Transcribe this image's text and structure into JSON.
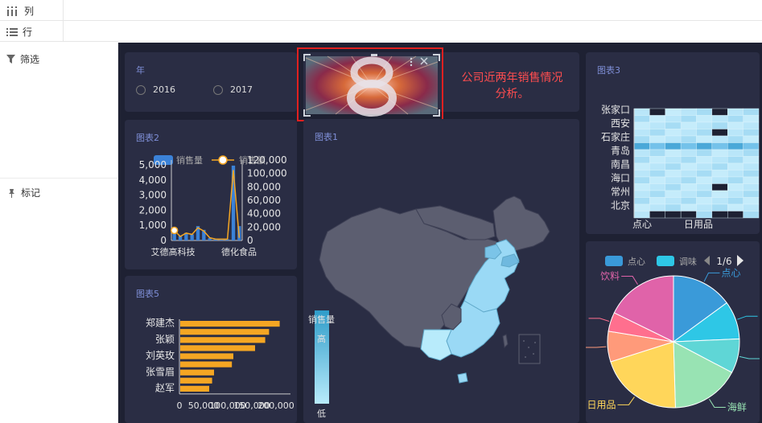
{
  "shelf": {
    "columns_label": "列",
    "rows_label": "行"
  },
  "side": {
    "filter_label": "筛选",
    "mark_label": "标记"
  },
  "year_panel": {
    "title": "年",
    "options": [
      "2016",
      "2017"
    ]
  },
  "title_panel": {
    "line1": "公司近两年销售情况",
    "line2": "分析。"
  },
  "chart2": {
    "title": "图表2"
  },
  "chart1": {
    "title": "图表1",
    "legend_title": "销售量",
    "high": "高",
    "low": "低"
  },
  "chart3": {
    "title": "图表3"
  },
  "chart5": {
    "title": "图表5"
  },
  "pie": {
    "page": "1/6"
  },
  "colors": {
    "accent_title": "#7f8fd8",
    "bar_orange": "#f5a623",
    "bar_blue": "#3b82d8",
    "map_fill": "#5c5e70",
    "map_high": "#9ad9f5",
    "title_red": "#ff4d4f"
  },
  "chart_data": [
    {
      "type": "bar",
      "title": "图表2",
      "legend": [
        "销售量",
        "销售额"
      ],
      "categories": [
        "艾德高科技",
        "",
        "",
        "",
        "",
        "",
        "",
        "",
        "",
        "",
        "",
        "德化食品"
      ],
      "y_ticks": [
        "5,000",
        "4,000",
        "3,000",
        "2,000",
        "1,000",
        "0"
      ],
      "y2_ticks": [
        "120,000",
        "100,000",
        "80,000",
        "60,000",
        "40,000",
        "20,000",
        "0"
      ],
      "series": [
        {
          "name": "销售量",
          "values": [
            650,
            300,
            500,
            400,
            950,
            700,
            150,
            100,
            100,
            80,
            4950,
            950
          ]
        },
        {
          "name": "销售额",
          "values": [
            15000,
            6000,
            11000,
            9000,
            19000,
            14000,
            4000,
            2000,
            2000,
            2000,
            105000,
            4000
          ]
        }
      ],
      "ylim": [
        0,
        5000
      ],
      "y2lim": [
        0,
        120000
      ]
    },
    {
      "type": "heatmap",
      "title": "图表3",
      "y_labels": [
        "张家口",
        "西安",
        "石家庄",
        "青岛",
        "南昌",
        "海口",
        "常州",
        "北京"
      ],
      "x_labels": [
        "点心",
        "日用品"
      ]
    },
    {
      "type": "bar",
      "title": "图表5",
      "orientation": "horizontal",
      "categories": [
        "郑建杰",
        "",
        "张颖",
        "",
        "刘英玫",
        "",
        "张雪眉",
        "",
        "赵军"
      ],
      "values": [
        206000,
        184000,
        176000,
        155000,
        110000,
        107000,
        70000,
        66000,
        60000
      ],
      "x_ticks": [
        "0",
        "50,000",
        "100,000",
        "150,000",
        "200,000"
      ],
      "xlim": [
        0,
        230000
      ]
    },
    {
      "type": "pie",
      "legend": [
        "点心",
        "调味"
      ],
      "slices": [
        {
          "label": "点心",
          "value": 16,
          "color": "#3a9ad9"
        },
        {
          "label": "",
          "value": 10,
          "color": "#2ec7e6"
        },
        {
          "label": "",
          "value": 9,
          "color": "#5fd6d6"
        },
        {
          "label": "海鲜",
          "value": 18,
          "color": "#98e3b3"
        },
        {
          "label": "日用品",
          "value": 22,
          "color": "#ffd65a"
        },
        {
          "label": "",
          "value": 8,
          "color": "#ff9a7a"
        },
        {
          "label": "",
          "value": 5,
          "color": "#ff6f8e"
        },
        {
          "label": "饮料",
          "value": 19,
          "color": "#e063a9"
        }
      ]
    }
  ]
}
